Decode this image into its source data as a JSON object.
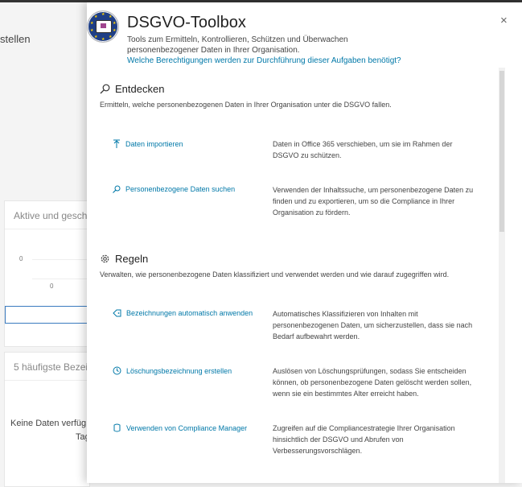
{
  "background": {
    "title_fragment": "stellen",
    "card1": {
      "title": "Aktive und geschl",
      "axis_y": "0",
      "axis_x": "0"
    },
    "card2": {
      "title": "5 häufigste Bezei",
      "nodata_line1": "Keine Daten verfüg",
      "nodata_line2": "Tag"
    }
  },
  "panel": {
    "title": "DSGVO-Toolbox",
    "subtitle": "Tools zum Ermitteln, Kontrollieren, Schützen und Überwachen personenbezogener Daten in Ihrer Organisation.",
    "permissions_link": "Welche Berechtigungen werden zur Durchführung dieser Aufgaben benötigt?",
    "close_icon": "×"
  },
  "sections": [
    {
      "heading": "Entdecken",
      "icon": "search-icon",
      "description": "Ermitteln, welche personenbezogenen Daten in Ihrer Organisation unter die DSGVO fallen.",
      "actions": [
        {
          "label": "Daten importieren",
          "icon": "upload-arrow-icon",
          "description": "Daten in Office 365 verschieben, um sie im Rahmen der DSGVO zu schützen."
        },
        {
          "label": "Personenbezogene Daten suchen",
          "icon": "search-icon",
          "description": "Verwenden der Inhaltssuche, um personenbezogene Daten zu finden und zu exportieren, um so die Compliance in Ihrer Organisation zu fördern."
        }
      ]
    },
    {
      "heading": "Regeln",
      "icon": "gear-icon",
      "description": "Verwalten, wie personenbezogene Daten klassifiziert und verwendet werden und wie darauf zugegriffen wird.",
      "actions": [
        {
          "label": "Bezeichnungen automatisch anwenden",
          "icon": "tag-icon",
          "description": "Automatisches Klassifizieren von Inhalten mit personenbezogenen Daten, um sicherzustellen, dass sie nach Bedarf aufbewahrt werden."
        },
        {
          "label": "Löschungsbezeichnung erstellen",
          "icon": "clock-icon",
          "description": "Auslösen von Löschungsprüfungen, sodass Sie entscheiden können, ob personenbezogene Daten gelöscht werden sollen, wenn sie ein bestimmtes Alter erreicht haben."
        },
        {
          "label": "Verwenden von Compliance Manager",
          "icon": "compliance-icon",
          "description": "Zugreifen auf die Compliancestrategie Ihrer Organisation hinsichtlich der DSGVO und Abrufen von Verbesserungsvorschlägen."
        }
      ]
    }
  ]
}
